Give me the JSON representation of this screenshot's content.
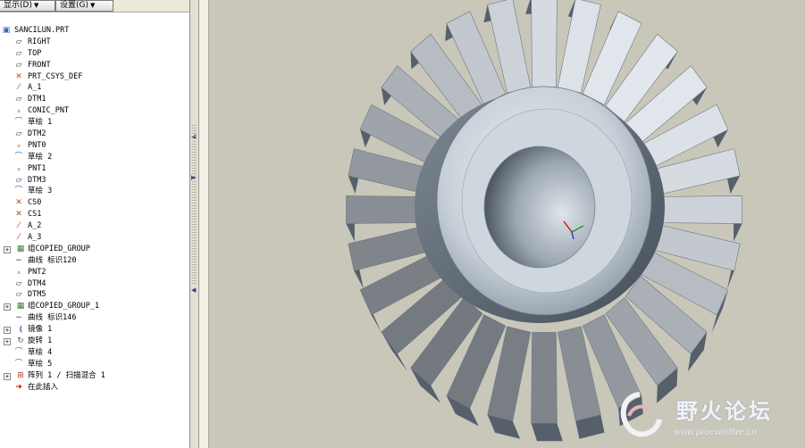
{
  "toolbar": {
    "display_label": "显示(D)",
    "settings_label": "设置(G)"
  },
  "tree": {
    "items": [
      {
        "label": "SANCILUN.PRT",
        "icon": "part-icon",
        "indent": 0,
        "expander": ""
      },
      {
        "label": "RIGHT",
        "icon": "datum-plane-icon",
        "indent": 1,
        "expander": ""
      },
      {
        "label": "TOP",
        "icon": "datum-plane-icon",
        "indent": 1,
        "expander": ""
      },
      {
        "label": "FRONT",
        "icon": "datum-plane-icon",
        "indent": 1,
        "expander": ""
      },
      {
        "label": "PRT_CSYS_DEF",
        "icon": "csys-icon",
        "indent": 1,
        "expander": ""
      },
      {
        "label": "A_1",
        "icon": "axis-icon",
        "indent": 1,
        "expander": ""
      },
      {
        "label": "DTM1",
        "icon": "datum-plane-icon",
        "indent": 1,
        "expander": ""
      },
      {
        "label": "CONIC_PNT",
        "icon": "datum-point-icon",
        "indent": 1,
        "expander": ""
      },
      {
        "label": "草绘 1",
        "icon": "sketch-icon",
        "indent": 1,
        "expander": ""
      },
      {
        "label": "DTM2",
        "icon": "datum-plane-icon",
        "indent": 1,
        "expander": ""
      },
      {
        "label": "PNT0",
        "icon": "datum-point-icon",
        "indent": 1,
        "expander": ""
      },
      {
        "label": "草绘 2",
        "icon": "sketch-icon",
        "indent": 1,
        "expander": ""
      },
      {
        "label": "PNT1",
        "icon": "datum-point-icon",
        "indent": 1,
        "expander": ""
      },
      {
        "label": "DTM3",
        "icon": "datum-plane-icon",
        "indent": 1,
        "expander": ""
      },
      {
        "label": "草绘 3",
        "icon": "sketch-icon",
        "indent": 1,
        "expander": ""
      },
      {
        "label": "CS0",
        "icon": "csys-icon",
        "indent": 1,
        "expander": ""
      },
      {
        "label": "CS1",
        "icon": "csys-icon",
        "indent": 1,
        "expander": ""
      },
      {
        "label": "A_2",
        "icon": "axis-icon",
        "indent": 1,
        "expander": ""
      },
      {
        "label": "A_3",
        "icon": "axis-icon",
        "indent": 1,
        "expander": ""
      },
      {
        "label": "组COPIED_GROUP",
        "icon": "group-icon",
        "indent": 1,
        "expander": "+"
      },
      {
        "label": "曲线 标识120",
        "icon": "curve-icon",
        "indent": 1,
        "expander": ""
      },
      {
        "label": "PNT2",
        "icon": "datum-point-icon",
        "indent": 1,
        "expander": ""
      },
      {
        "label": "DTM4",
        "icon": "datum-plane-icon",
        "indent": 1,
        "expander": ""
      },
      {
        "label": "DTM5",
        "icon": "datum-plane-icon",
        "indent": 1,
        "expander": ""
      },
      {
        "label": "组COPIED_GROUP_1",
        "icon": "group-icon",
        "indent": 1,
        "expander": "+"
      },
      {
        "label": "曲线 标识146",
        "icon": "curve-icon",
        "indent": 1,
        "expander": ""
      },
      {
        "label": "镜像 1",
        "icon": "mirror-icon",
        "indent": 1,
        "expander": "+"
      },
      {
        "label": "旋转 1",
        "icon": "revolve-icon",
        "indent": 1,
        "expander": "+"
      },
      {
        "label": "草绘 4",
        "icon": "sketch-icon",
        "indent": 1,
        "expander": ""
      },
      {
        "label": "草绘 5",
        "icon": "sketch-icon",
        "indent": 1,
        "expander": ""
      },
      {
        "label": "阵列 1 / 扫描混合 1",
        "icon": "pattern-icon",
        "indent": 1,
        "expander": "+"
      },
      {
        "label": "在此插入",
        "icon": "insert-here-icon",
        "indent": 1,
        "expander": ""
      }
    ]
  },
  "watermark": {
    "title": "野火论坛",
    "url": "www.proewildfire.cn"
  },
  "colors": {
    "viewport_bg": "#c9c7b9",
    "gear_light": "#e6ebef",
    "gear_mid": "#a9b3bd",
    "gear_dark": "#5a6470"
  }
}
